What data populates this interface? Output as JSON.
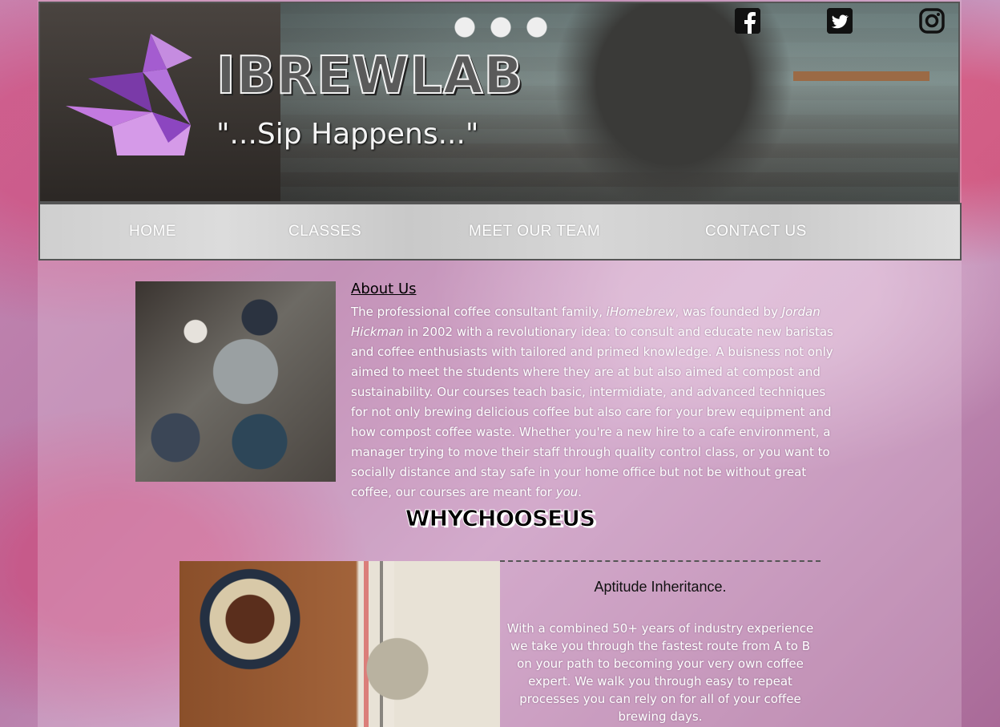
{
  "header": {
    "brand": "IBREWLAB",
    "tagline": "\"...Sip Happens...\"",
    "logo_icon": "origami-swan-icon",
    "social": [
      {
        "name": "facebook",
        "icon": "facebook-icon"
      },
      {
        "name": "twitter",
        "icon": "twitter-icon"
      },
      {
        "name": "instagram",
        "icon": "instagram-icon"
      }
    ]
  },
  "nav": {
    "items": [
      {
        "label": "HOME"
      },
      {
        "label": "CLASSES"
      },
      {
        "label": "MEET OUR TEAM"
      },
      {
        "label": "CONTACT US"
      }
    ]
  },
  "about": {
    "title": "About Us",
    "p1": "The professional coffee consultant family, ",
    "family_name": "iHomebrew",
    "p2": ", was founded by ",
    "founder": "Jordan Hickman",
    "p3": " in 2002 with a revolutionary idea: to consult and educate new baristas and coffee enthusiasts with tailored and primed knowledge. A buisness not only aimed to meet the students where they are at but also aimed at compost and sustainability. Our courses teach basic, intermidiate, and advanced techniques for not only brewing delicious coffee but also care for your brew equipment and how compost coffee waste. Whether you're a new hire to a cafe environment, a manager trying to move their staff through quality control class, or you want to socially distance and stay safe in your home office but not be without great coffee, our courses are meant for ",
    "emphasis": "you",
    "p4": "."
  },
  "why": {
    "heading": "WHYCHOOSEUS",
    "feature_title": "Aptitude Inheritance.",
    "feature_text": "With a combined 50+ years of industry experience we take you through the fastest route from A to B on your path to becoming your very own coffee expert. We walk you through easy to repeat processes you can rely on for all of your coffee brewing days."
  },
  "colors": {
    "accent_purple": "#9b4fd0",
    "background_pink": "#c78bb6",
    "nav_gray": "#d0d0d0"
  }
}
